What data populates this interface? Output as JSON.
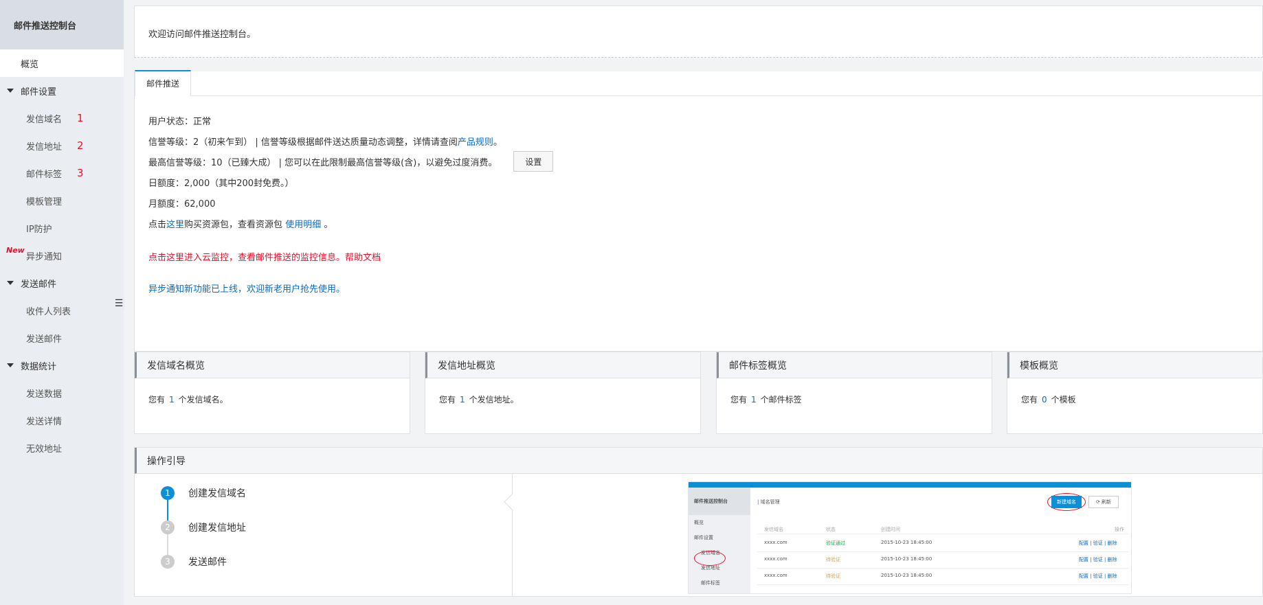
{
  "sidebar": {
    "title": "邮件推送控制台",
    "overview": "概览",
    "groups": [
      {
        "label": "邮件设置",
        "items": [
          {
            "label": "发信域名",
            "num": "1"
          },
          {
            "label": "发信地址",
            "num": "2"
          },
          {
            "label": "邮件标签",
            "num": "3"
          },
          {
            "label": "模板管理"
          },
          {
            "label": "IP防护"
          },
          {
            "label": "异步通知",
            "badge": "New"
          }
        ]
      },
      {
        "label": "发送邮件",
        "items": [
          {
            "label": "收件人列表"
          },
          {
            "label": "发送邮件"
          }
        ]
      },
      {
        "label": "数据统计",
        "items": [
          {
            "label": "发送数据"
          },
          {
            "label": "发送详情"
          },
          {
            "label": "无效地址"
          }
        ]
      }
    ],
    "collapse_icon": "menu-icon"
  },
  "welcome": "欢迎访问邮件推送控制台。",
  "tab": "邮件推送",
  "status": {
    "user_status_label": "用户状态：",
    "user_status": "正常",
    "credit_level": "信誉等级：2（初来乍到） | 信誉等级根据邮件送达质量动态调整，详情请查阅",
    "product_rules": "产品规则",
    "period": "。",
    "max_level": "最高信誉等级：10（已臻大成） | 您可以在此限制最高信誉等级(含)，以避免过度消费。",
    "set_button": "设置",
    "daily_quota": "日额度：2,000（其中200封免费。）",
    "monthly_quota": "月额度：62,000",
    "buy_prefix": "点击",
    "buy_here": "这里",
    "buy_mid": "购买资源包，查看资源包",
    "usage_detail": "使用明细",
    "buy_suffix": "。",
    "monitor_notice": "点击这里进入云监控，查看邮件推送的监控信息。帮助文档",
    "async_notice": "异步通知新功能已上线，欢迎新老用户抢先使用。"
  },
  "cards": [
    {
      "title": "发信域名概览",
      "prefix": "您有",
      "count": "1",
      "suffix": "个发信域名。"
    },
    {
      "title": "发信地址概览",
      "prefix": "您有",
      "count": "1",
      "suffix": "个发信地址。"
    },
    {
      "title": "邮件标签概览",
      "prefix": "您有",
      "count": "1",
      "suffix": "个邮件标签"
    },
    {
      "title": "模板概览",
      "prefix": "您有",
      "count": "0",
      "suffix": "个模板"
    }
  ],
  "guide": {
    "title": "操作引导",
    "steps": [
      {
        "num": "1",
        "label": "创建发信域名"
      },
      {
        "num": "2",
        "label": "创建发信地址"
      },
      {
        "num": "3",
        "label": "发送邮件"
      }
    ],
    "preview": {
      "title": "邮件推送控制台",
      "nav": [
        "概览",
        "邮件设置",
        "发信域名",
        "发信地址",
        "邮件标签"
      ],
      "heading": "| 域名管理",
      "new_button": "新建域名",
      "refresh_button": "⟳ 刷新",
      "columns": [
        "发信域名",
        "状态",
        "创建时间",
        "操作"
      ],
      "rows": [
        {
          "domain": "xxxx.com",
          "status": "验证通过",
          "time": "2015-10-23 18:45:00",
          "actions": "配置 | 验证 | 删除"
        },
        {
          "domain": "xxxx.com",
          "status": "待验证",
          "time": "2015-10-23 18:45:00",
          "actions": "配置 | 验证 | 删除"
        },
        {
          "domain": "xxxx.com",
          "status": "待验证",
          "time": "2015-10-23 18:45:00",
          "actions": "配置 | 验证 | 删除"
        }
      ]
    }
  }
}
